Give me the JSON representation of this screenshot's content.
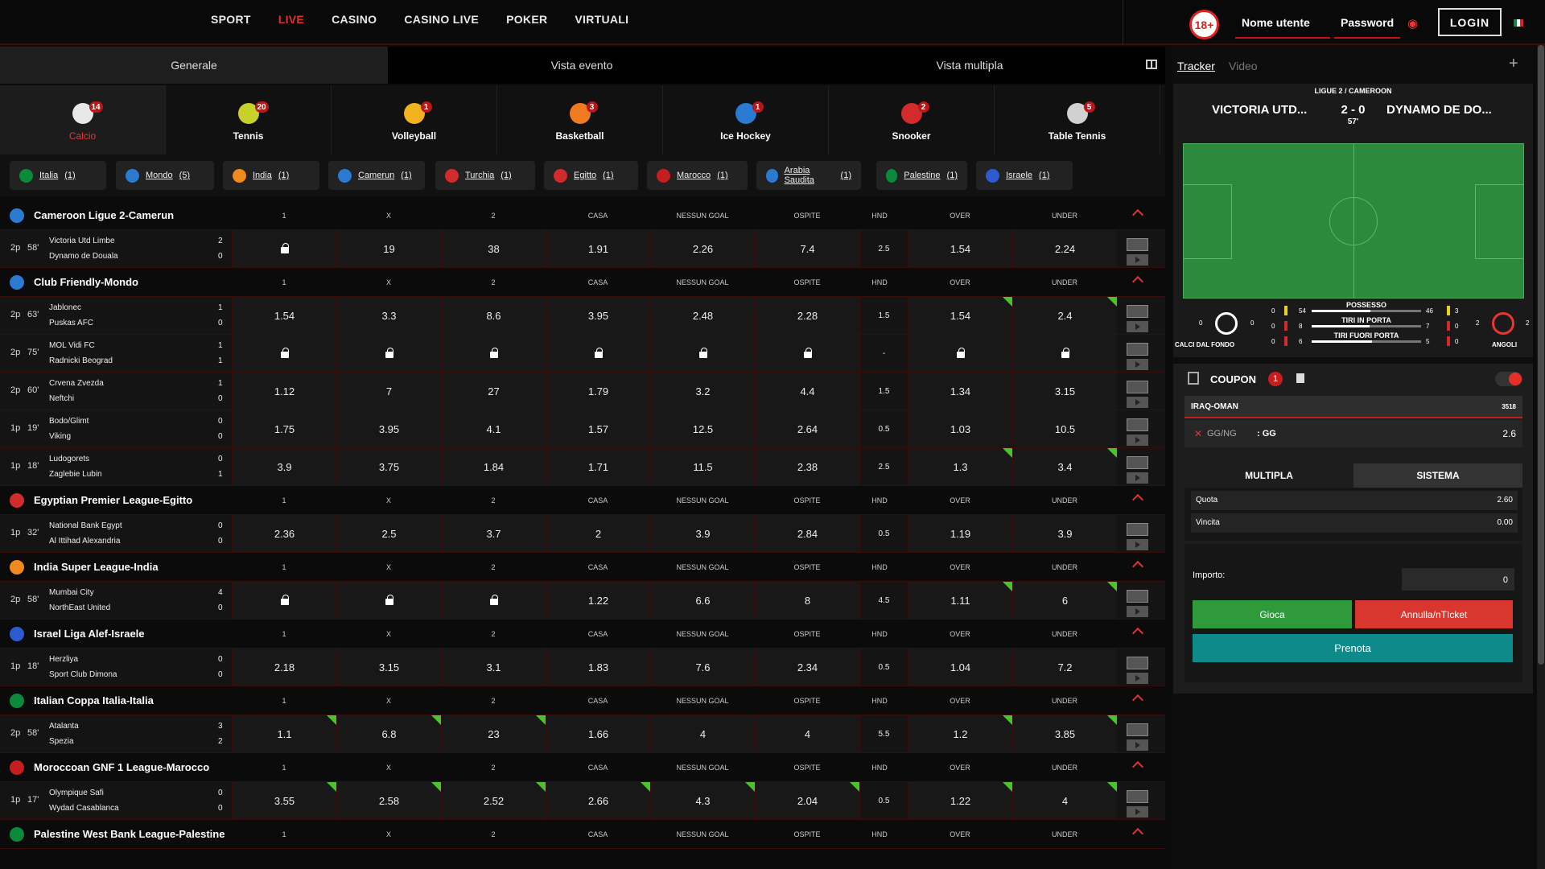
{
  "nav": {
    "items": [
      "SPORT",
      "LIVE",
      "CASINO",
      "CASINO LIVE",
      "POKER",
      "VIRTUALI"
    ],
    "active": "LIVE"
  },
  "login": {
    "age": "18+",
    "username": "Nome utente",
    "password": "Password",
    "button": "LOGIN"
  },
  "view_tabs": [
    "Generale",
    "Vista evento",
    "Vista multipla"
  ],
  "sports": [
    {
      "name": "Calcio",
      "count": "14",
      "active": true,
      "color": "#e8e8e8"
    },
    {
      "name": "Tennis",
      "count": "20",
      "color": "#c6d12b"
    },
    {
      "name": "Volleyball",
      "count": "1",
      "color": "#f0b21f"
    },
    {
      "name": "Basketball",
      "count": "3",
      "color": "#f07a1f"
    },
    {
      "name": "Ice Hockey",
      "count": "1",
      "color": "#2b7ad1"
    },
    {
      "name": "Snooker",
      "count": "2",
      "color": "#d12b2b"
    },
    {
      "name": "Table Tennis",
      "count": "5",
      "color": "#d1d1d1"
    }
  ],
  "chips": [
    {
      "label": "Italia",
      "count": "(1)",
      "c": "#0a8a3a"
    },
    {
      "label": "Mondo",
      "count": "(5)",
      "c": "#2b7ad1"
    },
    {
      "label": "India",
      "count": "(1)",
      "c": "#f08a1f"
    },
    {
      "label": "Camerun",
      "count": "(1)",
      "c": "#2b7ad1"
    },
    {
      "label": "Turchia",
      "count": "(1)",
      "c": "#d12b2b"
    },
    {
      "label": "Egitto",
      "count": "(1)",
      "c": "#d12b2b"
    },
    {
      "label": "Marocco",
      "count": "(1)",
      "c": "#c41e1e"
    },
    {
      "label": "Arabia Saudita",
      "count": "(1)",
      "c": "#2b7ad1"
    },
    {
      "label": "Palestine",
      "count": "(1)",
      "c": "#0a8a3a"
    },
    {
      "label": "Israele",
      "count": "(1)",
      "c": "#2b5ad1"
    }
  ],
  "headers": [
    "1",
    "X",
    "2",
    "CASA",
    "NESSUN GOAL",
    "OSPITE",
    "HND",
    "OVER",
    "UNDER"
  ],
  "leagues": [
    {
      "name": "Cameroon Ligue 2-Camerun",
      "c": "#2b7ad1",
      "rows": [
        {
          "p": "2p",
          "m": "58'",
          "h": "Victoria Utd Limbe",
          "a": "Dynamo de Douala",
          "sh": "2",
          "sa": "0",
          "o": [
            "L",
            "19",
            "38",
            "1.91",
            "2.26",
            "7.4",
            "2.5",
            "1.54",
            "2.24"
          ],
          "g": []
        }
      ]
    },
    {
      "name": "Club Friendly-Mondo",
      "c": "#2b7ad1",
      "rows": [
        {
          "p": "2p",
          "m": "63'",
          "h": "Jablonec",
          "a": "Puskas AFC",
          "sh": "1",
          "sa": "0",
          "o": [
            "1.54",
            "3.3",
            "8.6",
            "3.95",
            "2.48",
            "2.28",
            "1.5",
            "1.54",
            "2.4"
          ],
          "g": [
            7,
            8
          ]
        },
        {
          "p": "2p",
          "m": "75'",
          "h": "MOL Vidi FC",
          "a": "Radnicki Beograd",
          "sh": "1",
          "sa": "1",
          "o": [
            "L",
            "L",
            "L",
            "L",
            "L",
            "L",
            "-",
            "L",
            "L"
          ],
          "g": []
        },
        {
          "p": "2p",
          "m": "60'",
          "h": "Crvena Zvezda",
          "a": "Neftchi",
          "sh": "1",
          "sa": "0",
          "o": [
            "1.12",
            "7",
            "27",
            "1.79",
            "3.2",
            "4.4",
            "1.5",
            "1.34",
            "3.15"
          ],
          "g": []
        },
        {
          "p": "1p",
          "m": "19'",
          "h": "Bodo/Glimt",
          "a": "Viking",
          "sh": "0",
          "sa": "0",
          "o": [
            "1.75",
            "3.95",
            "4.1",
            "1.57",
            "12.5",
            "2.64",
            "0.5",
            "1.03",
            "10.5"
          ],
          "g": []
        },
        {
          "p": "1p",
          "m": "18'",
          "h": "Ludogorets",
          "a": "Zaglebie Lubin",
          "sh": "0",
          "sa": "1",
          "o": [
            "3.9",
            "3.75",
            "1.84",
            "1.71",
            "11.5",
            "2.38",
            "2.5",
            "1.3",
            "3.4"
          ],
          "g": [
            7,
            8
          ]
        }
      ]
    },
    {
      "name": "Egyptian Premier League-Egitto",
      "c": "#d12b2b",
      "rows": [
        {
          "p": "1p",
          "m": "32'",
          "h": "National Bank Egypt",
          "a": "Al Ittihad Alexandria",
          "sh": "0",
          "sa": "0",
          "o": [
            "2.36",
            "2.5",
            "3.7",
            "2",
            "3.9",
            "2.84",
            "0.5",
            "1.19",
            "3.9"
          ],
          "g": []
        }
      ]
    },
    {
      "name": "India Super League-India",
      "c": "#f08a1f",
      "rows": [
        {
          "p": "2p",
          "m": "58'",
          "h": "Mumbai City",
          "a": "NorthEast United",
          "sh": "4",
          "sa": "0",
          "o": [
            "L",
            "L",
            "L",
            "1.22",
            "6.6",
            "8",
            "4.5",
            "1.11",
            "6"
          ],
          "g": [
            7,
            8
          ]
        }
      ]
    },
    {
      "name": "Israel Liga Alef-Israele",
      "c": "#2b5ad1",
      "rows": [
        {
          "p": "1p",
          "m": "18'",
          "h": "Herzliya",
          "a": "Sport Club Dimona",
          "sh": "0",
          "sa": "0",
          "o": [
            "2.18",
            "3.15",
            "3.1",
            "1.83",
            "7.6",
            "2.34",
            "0.5",
            "1.04",
            "7.2"
          ],
          "g": []
        }
      ]
    },
    {
      "name": "Italian Coppa Italia-Italia",
      "c": "#0a8a3a",
      "rows": [
        {
          "p": "2p",
          "m": "58'",
          "h": "Atalanta",
          "a": "Spezia",
          "sh": "3",
          "sa": "2",
          "o": [
            "1.1",
            "6.8",
            "23",
            "1.66",
            "4",
            "4",
            "5.5",
            "1.2",
            "3.85"
          ],
          "g": [
            0,
            1,
            2,
            7,
            8
          ]
        }
      ]
    },
    {
      "name": "Moroccoan GNF 1 League-Marocco",
      "c": "#c41e1e",
      "rows": [
        {
          "p": "1p",
          "m": "17'",
          "h": "Olympique Safi",
          "a": "Wydad Casablanca",
          "sh": "0",
          "sa": "0",
          "o": [
            "3.55",
            "2.58",
            "2.52",
            "2.66",
            "4.3",
            "2.04",
            "0.5",
            "1.22",
            "4"
          ],
          "g": [
            0,
            1,
            2,
            3,
            4,
            5,
            7,
            8
          ]
        }
      ]
    },
    {
      "name": "Palestine West Bank League-Palestine",
      "c": "#0a8a3a",
      "rows": []
    }
  ],
  "tracker": {
    "tab_tracker": "Tracker",
    "tab_video": "Video",
    "league": "LIGUE 2 / CAMEROON",
    "home": "VICTORIA UTD...",
    "away": "DYNAMO DE DO...",
    "score": "2 - 0",
    "minute": "57'",
    "stats": [
      {
        "l": "POSSESSO",
        "h": "54",
        "a": "46",
        "f": 0.54
      },
      {
        "l": "TIRI IN PORTA",
        "h": "8",
        "a": "7",
        "f": 0.53
      },
      {
        "l": "TIRI FUORI PORTA",
        "h": "6",
        "a": "5",
        "f": 0.55
      }
    ],
    "left_label": "CALCI DAL FONDO",
    "left_h": "0",
    "left_a": "0",
    "right_label": "ANGOLI",
    "right_h": "2",
    "right_a": "2",
    "cards": [
      {
        "h": "0",
        "a": "3"
      },
      {
        "h": "0",
        "a": "0"
      },
      {
        "h": "0",
        "a": "0"
      }
    ]
  },
  "coupon": {
    "title": "COUPON",
    "count": "1",
    "event": "IRAQ-OMAN",
    "code": "3518",
    "market": "GG/NG",
    "sel": ": GG",
    "odd": "2.6",
    "tab_multi": "MULTIPLA",
    "tab_sys": "SISTEMA",
    "quota_l": "Quota",
    "quota": "2.60",
    "vincita_l": "Vincita",
    "vincita": "0.00",
    "importo_l": "Importo:",
    "importo": "0",
    "gioca": "Gioca",
    "annulla": "Annulla/nTIcket",
    "prenota": "Prenota"
  }
}
